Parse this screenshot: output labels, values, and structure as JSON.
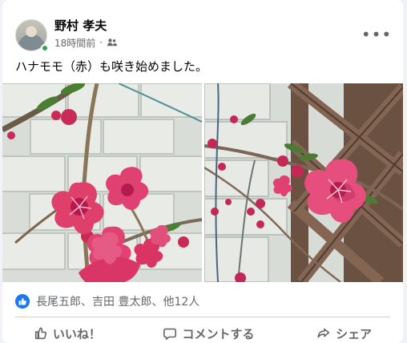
{
  "post": {
    "author": "野村 孝夫",
    "time": "18時間前",
    "dot": "·",
    "text": "ハナモモ（赤）も咲き始めました。",
    "more_icon": "more-horizontal-icon",
    "audience_icon": "friends-icon"
  },
  "reactions": {
    "summary": "長尾五郎、吉田 豊太郎、他12人",
    "icon": "thumbs-up-icon"
  },
  "actions": {
    "like": "いいね！",
    "comment": "コメントする",
    "share": "シェア"
  },
  "colors": {
    "facebook_blue": "#1877f2",
    "online_green": "#31a24c",
    "secondary_text": "#65676b",
    "divider": "#ced0d4",
    "blossom_pink": "#df3f6b"
  }
}
